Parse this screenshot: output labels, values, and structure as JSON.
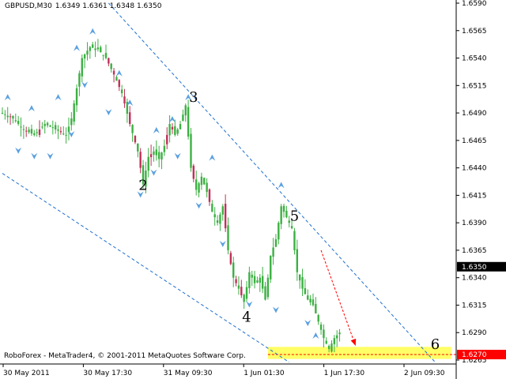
{
  "header": {
    "symbol": "GBPUSD,M30",
    "ohlc": "1.6349 1.6361 1.6348 1.6350"
  },
  "copyright": "RoboForex - MetaTrader4, © 2001-2011 MetaQuotes Software Corp.",
  "colors": {
    "background": "#ffffff",
    "candle": "#3cb043",
    "bear_candle": "#c0305a",
    "channel": "#1e6fd0",
    "fractal": "#5aa0e0",
    "target_zone": "#ffff66",
    "target_line": "#ff0000",
    "forecast_arrow": "#ff0000"
  },
  "chart_data": {
    "type": "candlestick",
    "title": "GBPUSD,M30",
    "ylim": [
      1.6265,
      1.659
    ],
    "y_ticks": [
      "1.6590",
      "1.6565",
      "1.6540",
      "1.6515",
      "1.6490",
      "1.6465",
      "1.6440",
      "1.6415",
      "1.6390",
      "1.6365",
      "1.6340",
      "1.6315",
      "1.6290",
      "1.6265"
    ],
    "current_price": "1.6350",
    "target_price": "1.6270",
    "x_ticks": [
      "30 May 2011",
      "30 May 17:30",
      "31 May 09:30",
      "1 Jun 01:30",
      "1 Jun 17:30",
      "2 Jun 09:30"
    ],
    "close_path": [
      [
        0,
        1.649
      ],
      [
        4,
        1.6485
      ],
      [
        8,
        1.6475
      ],
      [
        12,
        1.647
      ],
      [
        16,
        1.648
      ],
      [
        20,
        1.6475
      ],
      [
        24,
        1.647
      ],
      [
        26,
        1.6485
      ],
      [
        30,
        1.654
      ],
      [
        33,
        1.655
      ],
      [
        36,
        1.6548
      ],
      [
        39,
        1.654
      ],
      [
        42,
        1.6525
      ],
      [
        45,
        1.6508
      ],
      [
        48,
        1.648
      ],
      [
        51,
        1.6455
      ],
      [
        53,
        1.6425
      ],
      [
        55,
        1.645
      ],
      [
        57,
        1.6455
      ],
      [
        59,
        1.6448
      ],
      [
        61,
        1.646
      ],
      [
        63,
        1.648
      ],
      [
        65,
        1.647
      ],
      [
        67,
        1.648
      ],
      [
        69,
        1.6497
      ],
      [
        71,
        1.644
      ],
      [
        73,
        1.642
      ],
      [
        75,
        1.6432
      ],
      [
        77,
        1.6418
      ],
      [
        79,
        1.64
      ],
      [
        81,
        1.639
      ],
      [
        83,
        1.6405
      ],
      [
        85,
        1.6365
      ],
      [
        87,
        1.634
      ],
      [
        89,
        1.633
      ],
      [
        91,
        1.6318
      ],
      [
        93,
        1.6345
      ],
      [
        95,
        1.6335
      ],
      [
        97,
        1.634
      ],
      [
        99,
        1.632
      ],
      [
        101,
        1.636
      ],
      [
        103,
        1.6375
      ],
      [
        105,
        1.6405
      ],
      [
        107,
        1.6395
      ],
      [
        109,
        1.6385
      ],
      [
        111,
        1.6345
      ],
      [
        113,
        1.633
      ],
      [
        115,
        1.632
      ],
      [
        117,
        1.6315
      ],
      [
        119,
        1.63
      ],
      [
        121,
        1.6285
      ],
      [
        123,
        1.6275
      ],
      [
        125,
        1.6285
      ],
      [
        127,
        1.629
      ]
    ],
    "bear_candle_indices": [
      3,
      9,
      14,
      22,
      40,
      42,
      44,
      46,
      48,
      50,
      52,
      56,
      62,
      64,
      72,
      78,
      84,
      86,
      88,
      90
    ],
    "fractals_up": [
      [
        2,
        1.65
      ],
      [
        11,
        1.649
      ],
      [
        21,
        1.65
      ],
      [
        28,
        1.6545
      ],
      [
        34,
        1.656
      ],
      [
        44,
        1.6522
      ],
      [
        48,
        1.6495
      ],
      [
        58,
        1.647
      ],
      [
        64,
        1.648
      ],
      [
        70,
        1.65
      ],
      [
        79,
        1.6445
      ],
      [
        105,
        1.642
      ],
      [
        118,
        1.6283
      ]
    ],
    "fractals_down": [
      [
        6,
        1.646
      ],
      [
        12,
        1.6455
      ],
      [
        18,
        1.6455
      ],
      [
        26,
        1.6475
      ],
      [
        31,
        1.652
      ],
      [
        40,
        1.6495
      ],
      [
        52,
        1.642
      ],
      [
        57,
        1.644
      ],
      [
        66,
        1.6455
      ],
      [
        74,
        1.641
      ],
      [
        83,
        1.6375
      ],
      [
        93,
        1.632
      ],
      [
        103,
        1.6315
      ],
      [
        115,
        1.6303
      ]
    ],
    "wave_labels": [
      {
        "label": "2",
        "i": 53,
        "p": 1.642
      },
      {
        "label": "3",
        "i": 72,
        "p": 1.65
      },
      {
        "label": "4",
        "i": 92,
        "p": 1.63
      },
      {
        "label": "5",
        "i": 110,
        "p": 1.6392
      },
      {
        "label": "6",
        "i": 163,
        "p": 1.6275
      }
    ],
    "channel_lines": [
      {
        "from": [
          0,
          1.6435
        ],
        "to": [
          108,
          1.6263
        ]
      },
      {
        "from": [
          40,
          1.659
        ],
        "to": [
          163,
          1.6263
        ]
      }
    ],
    "target_zone": {
      "i_from": 100,
      "i_to": 169,
      "p_low": 1.6266,
      "p_high": 1.6277
    },
    "forecast_arrow": {
      "from": [
        120,
        1.6365
      ],
      "to": [
        133,
        1.6278
      ]
    }
  }
}
